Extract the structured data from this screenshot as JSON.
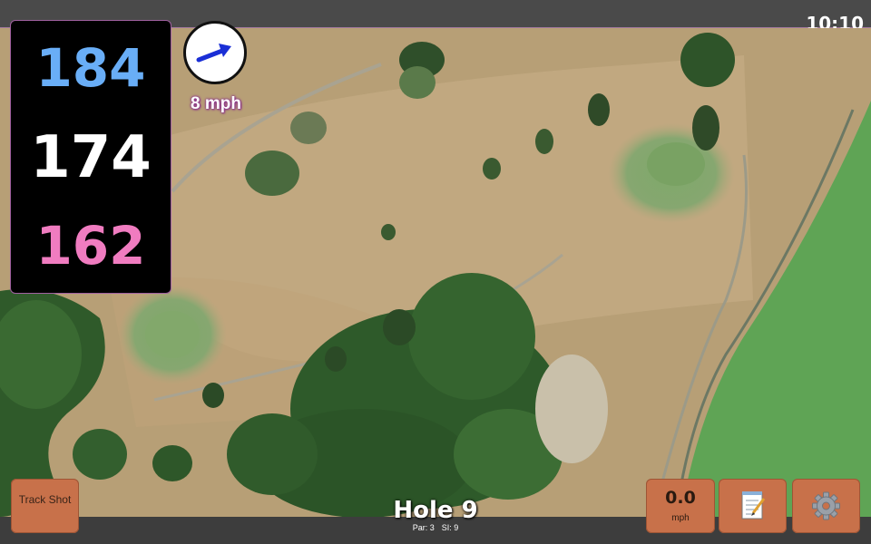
{
  "status": {
    "time": "10:10"
  },
  "distances": {
    "back": "184",
    "middle": "174",
    "front": "162"
  },
  "wind": {
    "speed_label": "8 mph",
    "direction_icon": "arrow-icon"
  },
  "hole": {
    "title": "Hole 9",
    "par": "Par: 3",
    "si": "SI: 9"
  },
  "buttons": {
    "track_shot": "Track Shot",
    "speed_value": "0.0",
    "speed_unit": "mph",
    "notes_icon": "notepad-icon",
    "settings_icon": "gear-icon"
  },
  "colors": {
    "back_distance": "#69aef7",
    "middle_distance": "#ffffff",
    "front_distance": "#f07cc0",
    "button": "#c8714a",
    "wind_arrow": "#1a2fd6"
  }
}
